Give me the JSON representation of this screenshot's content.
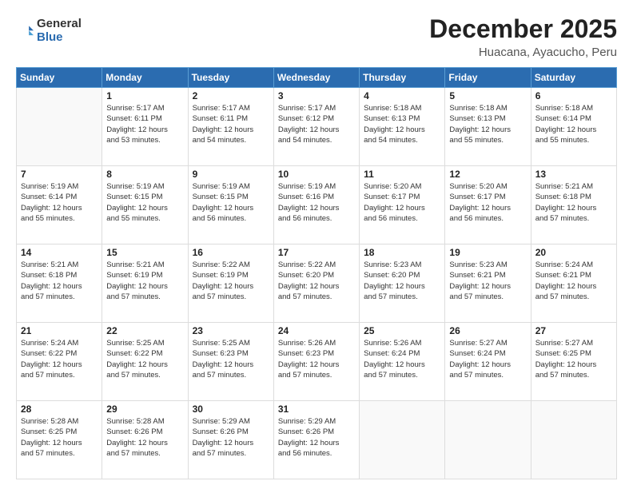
{
  "logo": {
    "general": "General",
    "blue": "Blue"
  },
  "header": {
    "title": "December 2025",
    "subtitle": "Huacana, Ayacucho, Peru"
  },
  "weekdays": [
    "Sunday",
    "Monday",
    "Tuesday",
    "Wednesday",
    "Thursday",
    "Friday",
    "Saturday"
  ],
  "weeks": [
    [
      {
        "day": "",
        "empty": true
      },
      {
        "day": "1",
        "sunrise": "Sunrise: 5:17 AM",
        "sunset": "Sunset: 6:11 PM",
        "daylight": "Daylight: 12 hours and 53 minutes."
      },
      {
        "day": "2",
        "sunrise": "Sunrise: 5:17 AM",
        "sunset": "Sunset: 6:11 PM",
        "daylight": "Daylight: 12 hours and 54 minutes."
      },
      {
        "day": "3",
        "sunrise": "Sunrise: 5:17 AM",
        "sunset": "Sunset: 6:12 PM",
        "daylight": "Daylight: 12 hours and 54 minutes."
      },
      {
        "day": "4",
        "sunrise": "Sunrise: 5:18 AM",
        "sunset": "Sunset: 6:13 PM",
        "daylight": "Daylight: 12 hours and 54 minutes."
      },
      {
        "day": "5",
        "sunrise": "Sunrise: 5:18 AM",
        "sunset": "Sunset: 6:13 PM",
        "daylight": "Daylight: 12 hours and 55 minutes."
      },
      {
        "day": "6",
        "sunrise": "Sunrise: 5:18 AM",
        "sunset": "Sunset: 6:14 PM",
        "daylight": "Daylight: 12 hours and 55 minutes."
      }
    ],
    [
      {
        "day": "7",
        "sunrise": "Sunrise: 5:19 AM",
        "sunset": "Sunset: 6:14 PM",
        "daylight": "Daylight: 12 hours and 55 minutes."
      },
      {
        "day": "8",
        "sunrise": "Sunrise: 5:19 AM",
        "sunset": "Sunset: 6:15 PM",
        "daylight": "Daylight: 12 hours and 55 minutes."
      },
      {
        "day": "9",
        "sunrise": "Sunrise: 5:19 AM",
        "sunset": "Sunset: 6:15 PM",
        "daylight": "Daylight: 12 hours and 56 minutes."
      },
      {
        "day": "10",
        "sunrise": "Sunrise: 5:19 AM",
        "sunset": "Sunset: 6:16 PM",
        "daylight": "Daylight: 12 hours and 56 minutes."
      },
      {
        "day": "11",
        "sunrise": "Sunrise: 5:20 AM",
        "sunset": "Sunset: 6:17 PM",
        "daylight": "Daylight: 12 hours and 56 minutes."
      },
      {
        "day": "12",
        "sunrise": "Sunrise: 5:20 AM",
        "sunset": "Sunset: 6:17 PM",
        "daylight": "Daylight: 12 hours and 56 minutes."
      },
      {
        "day": "13",
        "sunrise": "Sunrise: 5:21 AM",
        "sunset": "Sunset: 6:18 PM",
        "daylight": "Daylight: 12 hours and 57 minutes."
      }
    ],
    [
      {
        "day": "14",
        "sunrise": "Sunrise: 5:21 AM",
        "sunset": "Sunset: 6:18 PM",
        "daylight": "Daylight: 12 hours and 57 minutes."
      },
      {
        "day": "15",
        "sunrise": "Sunrise: 5:21 AM",
        "sunset": "Sunset: 6:19 PM",
        "daylight": "Daylight: 12 hours and 57 minutes."
      },
      {
        "day": "16",
        "sunrise": "Sunrise: 5:22 AM",
        "sunset": "Sunset: 6:19 PM",
        "daylight": "Daylight: 12 hours and 57 minutes."
      },
      {
        "day": "17",
        "sunrise": "Sunrise: 5:22 AM",
        "sunset": "Sunset: 6:20 PM",
        "daylight": "Daylight: 12 hours and 57 minutes."
      },
      {
        "day": "18",
        "sunrise": "Sunrise: 5:23 AM",
        "sunset": "Sunset: 6:20 PM",
        "daylight": "Daylight: 12 hours and 57 minutes."
      },
      {
        "day": "19",
        "sunrise": "Sunrise: 5:23 AM",
        "sunset": "Sunset: 6:21 PM",
        "daylight": "Daylight: 12 hours and 57 minutes."
      },
      {
        "day": "20",
        "sunrise": "Sunrise: 5:24 AM",
        "sunset": "Sunset: 6:21 PM",
        "daylight": "Daylight: 12 hours and 57 minutes."
      }
    ],
    [
      {
        "day": "21",
        "sunrise": "Sunrise: 5:24 AM",
        "sunset": "Sunset: 6:22 PM",
        "daylight": "Daylight: 12 hours and 57 minutes."
      },
      {
        "day": "22",
        "sunrise": "Sunrise: 5:25 AM",
        "sunset": "Sunset: 6:22 PM",
        "daylight": "Daylight: 12 hours and 57 minutes."
      },
      {
        "day": "23",
        "sunrise": "Sunrise: 5:25 AM",
        "sunset": "Sunset: 6:23 PM",
        "daylight": "Daylight: 12 hours and 57 minutes."
      },
      {
        "day": "24",
        "sunrise": "Sunrise: 5:26 AM",
        "sunset": "Sunset: 6:23 PM",
        "daylight": "Daylight: 12 hours and 57 minutes."
      },
      {
        "day": "25",
        "sunrise": "Sunrise: 5:26 AM",
        "sunset": "Sunset: 6:24 PM",
        "daylight": "Daylight: 12 hours and 57 minutes."
      },
      {
        "day": "26",
        "sunrise": "Sunrise: 5:27 AM",
        "sunset": "Sunset: 6:24 PM",
        "daylight": "Daylight: 12 hours and 57 minutes."
      },
      {
        "day": "27",
        "sunrise": "Sunrise: 5:27 AM",
        "sunset": "Sunset: 6:25 PM",
        "daylight": "Daylight: 12 hours and 57 minutes."
      }
    ],
    [
      {
        "day": "28",
        "sunrise": "Sunrise: 5:28 AM",
        "sunset": "Sunset: 6:25 PM",
        "daylight": "Daylight: 12 hours and 57 minutes."
      },
      {
        "day": "29",
        "sunrise": "Sunrise: 5:28 AM",
        "sunset": "Sunset: 6:26 PM",
        "daylight": "Daylight: 12 hours and 57 minutes."
      },
      {
        "day": "30",
        "sunrise": "Sunrise: 5:29 AM",
        "sunset": "Sunset: 6:26 PM",
        "daylight": "Daylight: 12 hours and 57 minutes."
      },
      {
        "day": "31",
        "sunrise": "Sunrise: 5:29 AM",
        "sunset": "Sunset: 6:26 PM",
        "daylight": "Daylight: 12 hours and 56 minutes."
      },
      {
        "day": "",
        "empty": true
      },
      {
        "day": "",
        "empty": true
      },
      {
        "day": "",
        "empty": true
      }
    ]
  ]
}
